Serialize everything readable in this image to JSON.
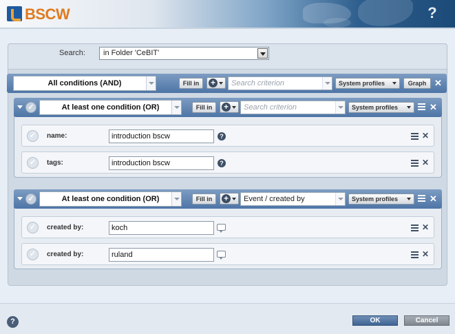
{
  "app": {
    "logo_text": "BSCW",
    "help_symbol": "?"
  },
  "search": {
    "label": "Search:",
    "scope_value": "in Folder 'CeBIT'"
  },
  "top_bar": {
    "condition_mode": "All conditions (AND)",
    "fill_in_label": "Fill in",
    "criterion_placeholder": "Search criterion",
    "profiles_label": "System profiles",
    "graph_label": "Graph"
  },
  "groups": [
    {
      "condition_mode": "At least one condition (OR)",
      "fill_in_label": "Fill in",
      "criterion_placeholder": "Search criterion",
      "profiles_label": "System profiles",
      "rows": [
        {
          "label": "name:",
          "value": "introduction bscw"
        },
        {
          "label": "tags:",
          "value": "introduction bscw"
        }
      ]
    },
    {
      "condition_mode": "At least one condition (OR)",
      "fill_in_label": "Fill in",
      "criterion_value": "Event / created by",
      "profiles_label": "System profiles",
      "rows": [
        {
          "label": "created by:",
          "value": "koch"
        },
        {
          "label": "created by:",
          "value": "ruland"
        }
      ]
    }
  ],
  "footer": {
    "ok_label": "OK",
    "cancel_label": "Cancel"
  },
  "colors": {
    "accent": "#4d75a6",
    "logo": "#e07a1f",
    "ok": "#3f6594"
  }
}
